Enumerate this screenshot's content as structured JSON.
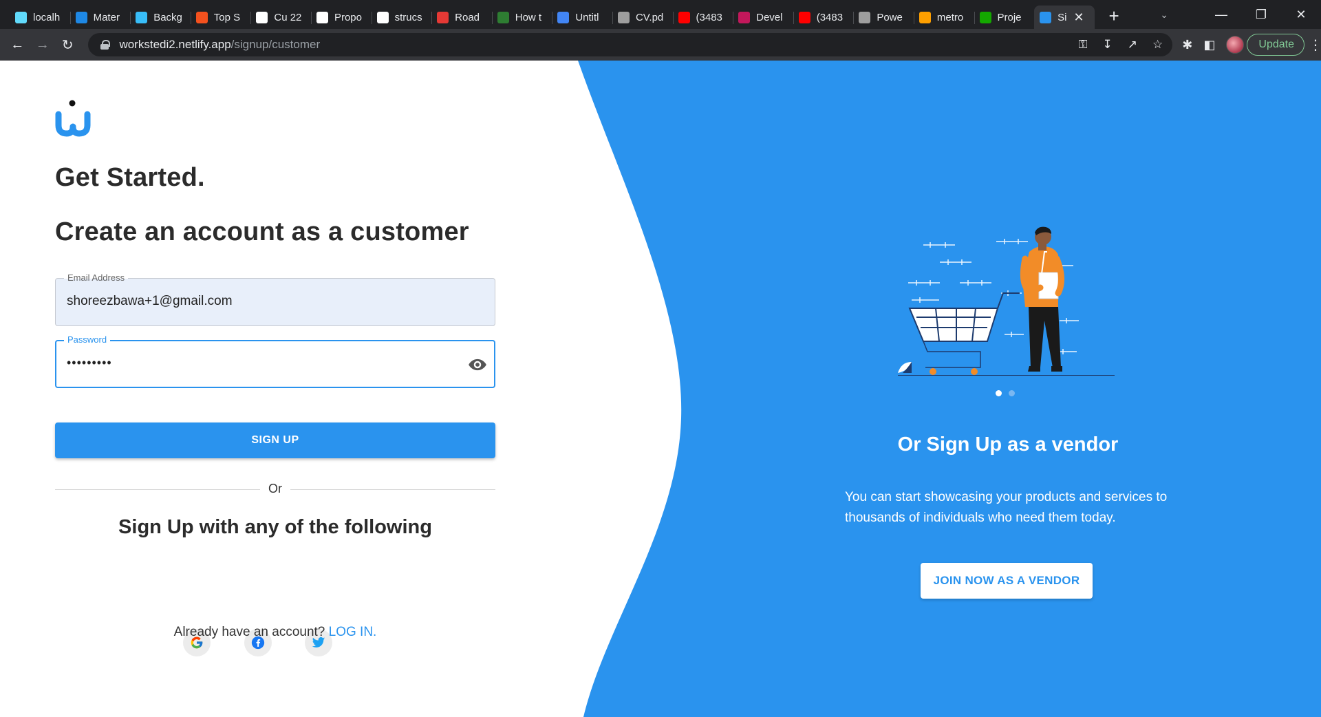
{
  "browser": {
    "tabs": [
      {
        "title": "localh",
        "icon": "react-icon",
        "color": "#61dafb"
      },
      {
        "title": "Mater",
        "icon": "mui-icon",
        "color": "#1e88e5"
      },
      {
        "title": "Backg",
        "icon": "tailwind-icon",
        "color": "#38bdf8"
      },
      {
        "title": "Top S",
        "icon": "codepen-icon",
        "color": "#f4511e"
      },
      {
        "title": "Cu 22",
        "icon": "github-icon",
        "color": "#ffffff"
      },
      {
        "title": "Propo",
        "icon": "github-icon",
        "color": "#ffffff"
      },
      {
        "title": "strucs",
        "icon": "github-icon",
        "color": "#ffffff"
      },
      {
        "title": "Road",
        "icon": "roadmap-icon",
        "color": "#e53935"
      },
      {
        "title": "How t",
        "icon": "dp-icon",
        "color": "#2e7d32"
      },
      {
        "title": "Untitl",
        "icon": "docs-icon",
        "color": "#4285f4"
      },
      {
        "title": "CV.pd",
        "icon": "pdf-icon",
        "color": "#9e9e9e"
      },
      {
        "title": "(3483",
        "icon": "youtube-icon",
        "color": "#ff0000"
      },
      {
        "title": "Devel",
        "icon": "dev-icon",
        "color": "#c2185b"
      },
      {
        "title": "(3483",
        "icon": "youtube-icon",
        "color": "#ff0000"
      },
      {
        "title": "Powe",
        "icon": "globe-icon",
        "color": "#9e9e9e"
      },
      {
        "title": "metro",
        "icon": "firebase-icon",
        "color": "#ffa000"
      },
      {
        "title": "Proje",
        "icon": "upwork-icon",
        "color": "#14a800"
      },
      {
        "title": "Si",
        "icon": "worksted-icon",
        "color": "#2a93ee",
        "active": true
      }
    ],
    "url_host": "workstedi2.netlify.app",
    "url_path": "/signup/customer",
    "update_label": "Update"
  },
  "page": {
    "heading_get_started": "Get Started.",
    "heading_create": "Create an account as a customer",
    "email_label": "Email Address",
    "email_value": "shoreezbawa+1@gmail.com",
    "password_label": "Password",
    "password_value": "•••••••••",
    "signup_button": "SIGN UP",
    "or_text": "Or",
    "social_heading": "Sign Up with any of the following",
    "social_icons": [
      "google-icon",
      "facebook-icon",
      "twitter-icon"
    ],
    "have_account_text": "Already have an account?",
    "login_link": "LOG IN.",
    "vendor_heading": "Or Sign Up as a vendor",
    "vendor_text": "You can start showcasing your products and services to thousands of individuals who need them today.",
    "vendor_button": "JOIN NOW AS A VENDOR",
    "carousel": {
      "slides": 2,
      "active": 1
    }
  },
  "colors": {
    "brand_blue": "#2a93ee",
    "heading": "#2b2b2b",
    "email_field_bg": "#e8effa",
    "illustration_orange": "#f28c28"
  }
}
